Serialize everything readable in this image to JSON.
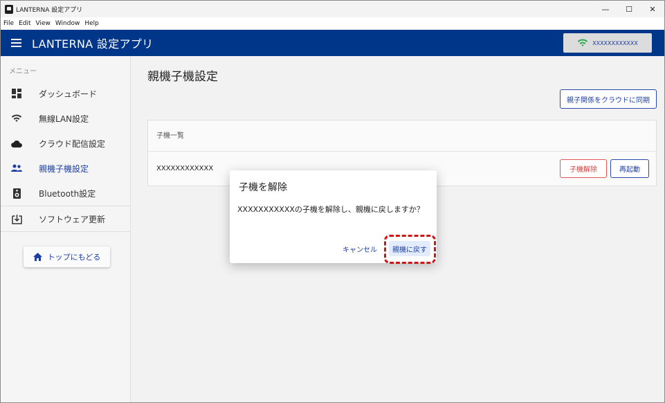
{
  "window": {
    "title": "LANTERNA 設定アプリ",
    "controls": {
      "minimize": "—",
      "maximize": "☐",
      "close": "✕"
    }
  },
  "menubar": {
    "items": [
      "File",
      "Edit",
      "View",
      "Window",
      "Help"
    ]
  },
  "appbar": {
    "title": "LANTERNA 設定アプリ",
    "wifi_ssid": "XXXXXXXXXXXX",
    "bg_color": "#00368a"
  },
  "sidebar": {
    "heading": "メニュー",
    "items": [
      {
        "label": "ダッシュボード",
        "icon": "dashboard-icon"
      },
      {
        "label": "無線LAN設定",
        "icon": "wifi-icon"
      },
      {
        "label": "クラウド配信設定",
        "icon": "cloud-icon"
      },
      {
        "label": "親機子機設定",
        "icon": "people-icon",
        "active": true
      },
      {
        "label": "Bluetooth設定",
        "icon": "speaker-icon"
      },
      {
        "label": "ソフトウェア更新",
        "icon": "download-box-icon"
      }
    ],
    "home_button": "トップにもどる"
  },
  "main": {
    "page_title": "親機子機設定",
    "sync_button": "親子関係をクラウドに同期",
    "card": {
      "header": "子機一覧",
      "rows": [
        {
          "name": "XXXXXXXXXXXX",
          "release_button": "子機解除",
          "reboot_button": "再起動"
        }
      ]
    }
  },
  "dialog": {
    "title": "子機を解除",
    "message": "XXXXXXXXXXXの子機を解除し、親機に戻しますか？",
    "cancel": "キャンセル",
    "confirm": "親機に戻す"
  },
  "colors": {
    "accent": "#1d3fa3",
    "danger": "#d94040",
    "highlight": "#d01515"
  }
}
